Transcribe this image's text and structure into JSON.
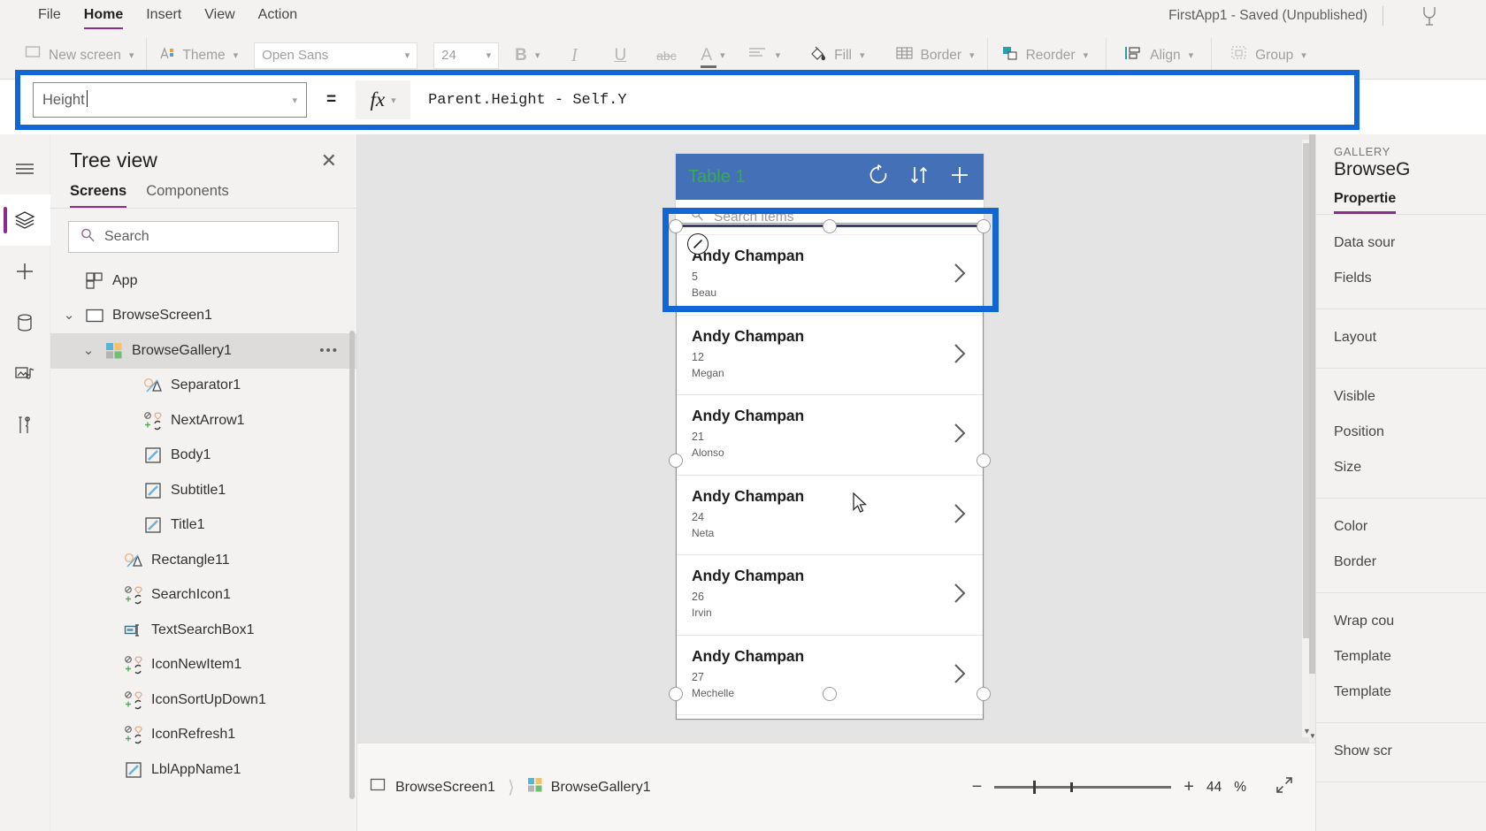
{
  "menu": {
    "items": [
      {
        "label": "File",
        "active": false
      },
      {
        "label": "Home",
        "active": true
      },
      {
        "label": "Insert",
        "active": false
      },
      {
        "label": "View",
        "active": false
      },
      {
        "label": "Action",
        "active": false
      }
    ],
    "app_title": "FirstApp1 - Saved (Unpublished)"
  },
  "ribbon": {
    "new_screen": "New screen",
    "theme": "Theme",
    "font_family": "Open Sans",
    "font_size": "24",
    "bold": "B",
    "italic": "I",
    "underline": "U",
    "strikethrough": "abc",
    "font_color": "A",
    "align": "align-icon",
    "fill": "Fill",
    "border": "Border",
    "reorder": "Reorder",
    "align_label": "Align",
    "group": "Group"
  },
  "formula_bar": {
    "property": "Height",
    "equals": "=",
    "fx_label": "fx",
    "formula": "Parent.Height - Self.Y"
  },
  "treeview": {
    "title": "Tree view",
    "close": "✕",
    "tabs": [
      {
        "label": "Screens",
        "active": true
      },
      {
        "label": "Components",
        "active": false
      }
    ],
    "search_placeholder": "Search",
    "items": [
      {
        "label": "App",
        "indent": 0,
        "twisty": "",
        "icon": "app-grid-icon",
        "selected": false,
        "dots": false
      },
      {
        "label": "BrowseScreen1",
        "indent": 0,
        "twisty": "⌄",
        "icon": "screen-icon",
        "selected": false,
        "dots": false
      },
      {
        "label": "BrowseGallery1",
        "indent": 1,
        "twisty": "⌄",
        "icon": "gallery-icon",
        "selected": true,
        "dots": true
      },
      {
        "label": "Separator1",
        "indent": 3,
        "twisty": "",
        "icon": "shape-icon",
        "selected": false,
        "dots": false
      },
      {
        "label": "NextArrow1",
        "indent": 3,
        "twisty": "",
        "icon": "icon-icon",
        "selected": false,
        "dots": false
      },
      {
        "label": "Body1",
        "indent": 3,
        "twisty": "",
        "icon": "label-icon",
        "selected": false,
        "dots": false
      },
      {
        "label": "Subtitle1",
        "indent": 3,
        "twisty": "",
        "icon": "label-icon",
        "selected": false,
        "dots": false
      },
      {
        "label": "Title1",
        "indent": 3,
        "twisty": "",
        "icon": "label-icon",
        "selected": false,
        "dots": false
      },
      {
        "label": "Rectangle11",
        "indent": 2,
        "twisty": "",
        "icon": "shape-icon",
        "selected": false,
        "dots": false
      },
      {
        "label": "SearchIcon1",
        "indent": 2,
        "twisty": "",
        "icon": "icon-icon",
        "selected": false,
        "dots": false
      },
      {
        "label": "TextSearchBox1",
        "indent": 2,
        "twisty": "",
        "icon": "textbox-icon",
        "selected": false,
        "dots": false
      },
      {
        "label": "IconNewItem1",
        "indent": 2,
        "twisty": "",
        "icon": "icon-icon",
        "selected": false,
        "dots": false
      },
      {
        "label": "IconSortUpDown1",
        "indent": 2,
        "twisty": "",
        "icon": "icon-icon",
        "selected": false,
        "dots": false
      },
      {
        "label": "IconRefresh1",
        "indent": 2,
        "twisty": "",
        "icon": "icon-icon",
        "selected": false,
        "dots": false
      },
      {
        "label": "LblAppName1",
        "indent": 2,
        "twisty": "",
        "icon": "label-icon",
        "selected": false,
        "dots": false
      }
    ]
  },
  "rail": {
    "items": [
      {
        "name": "hamburger-menu-icon",
        "active": false
      },
      {
        "name": "tree-view-icon",
        "active": true
      },
      {
        "name": "insert-icon",
        "active": false
      },
      {
        "name": "data-icon",
        "active": false
      },
      {
        "name": "media-icon",
        "active": false
      },
      {
        "name": "advanced-tools-icon",
        "active": false
      }
    ]
  },
  "canvas": {
    "gallery_header": {
      "title": "Table 1",
      "refresh_icon": "refresh-icon",
      "sort_icon": "sort-updown-icon",
      "add_icon": "add-icon"
    },
    "search_placeholder": "Search items",
    "items": [
      {
        "title": "Andy Champan",
        "subtitle": "5",
        "body": "Beau"
      },
      {
        "title": "Andy Champan",
        "subtitle": "12",
        "body": "Megan"
      },
      {
        "title": "Andy Champan",
        "subtitle": "21",
        "body": "Alonso"
      },
      {
        "title": "Andy Champan",
        "subtitle": "24",
        "body": "Neta"
      },
      {
        "title": "Andy Champan",
        "subtitle": "26",
        "body": "Irvin"
      },
      {
        "title": "Andy Champan",
        "subtitle": "27",
        "body": "Mechelle"
      }
    ]
  },
  "statusbar": {
    "breadcrumb": [
      {
        "label": "BrowseScreen1",
        "icon": "screen-icon"
      },
      {
        "label": "BrowseGallery1",
        "icon": "gallery-icon"
      }
    ],
    "zoom_minus": "−",
    "zoom_plus": "+",
    "zoom_value": "44",
    "zoom_unit": "%",
    "fit_icon": "fit-screen-icon"
  },
  "properties_panel": {
    "kicker": "GALLERY",
    "control_name": "BrowseG",
    "tab": "Propertie",
    "groups": [
      [
        "Data sour",
        "Fields"
      ],
      [
        "Layout"
      ],
      [
        "Visible",
        "Position",
        "Size"
      ],
      [
        "Color",
        "Border"
      ],
      [
        "Wrap cou",
        "Template ",
        "Template "
      ],
      [
        "Show scr"
      ]
    ]
  },
  "colors": {
    "highlight_blue": "#1266d3",
    "accent_purple": "#8a2d8f",
    "gallery_header_blue": "#4470b8",
    "gallery_title_green": "#3aa955",
    "ribbon_bg": "#f3f2f1",
    "canvas_bg": "#e4e4e4"
  }
}
